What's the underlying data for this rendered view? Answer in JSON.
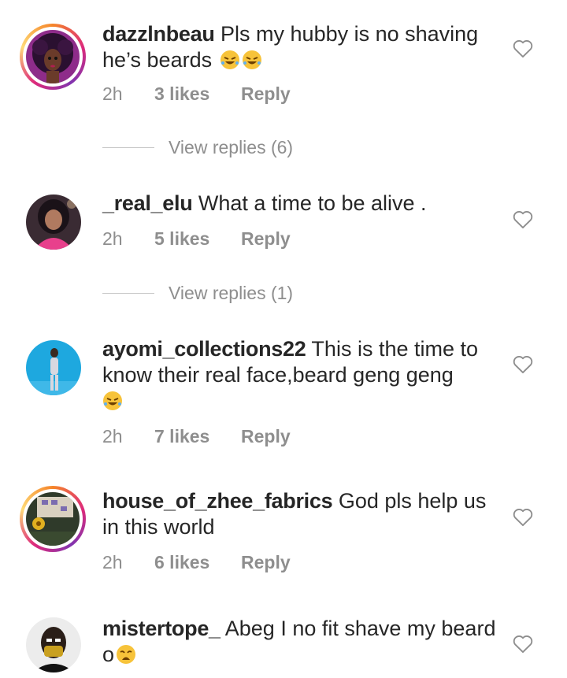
{
  "comments": [
    {
      "username": "dazzlnbeau",
      "text": " Pls my hubby is no shaving he’s beards ",
      "emojis": [
        "rofl-emoji",
        "rofl-emoji"
      ],
      "time": "2h",
      "likes": "3 likes",
      "reply": "Reply",
      "has_story_ring": true,
      "view_replies": "View replies (6)"
    },
    {
      "username": "_real_elu",
      "text": " What a time to be alive .",
      "emojis": [],
      "time": "2h",
      "likes": "5 likes",
      "reply": "Reply",
      "has_story_ring": false,
      "view_replies": "View replies (1)"
    },
    {
      "username": "ayomi_collections22",
      "text": " This is the time to know their real face,beard geng geng ",
      "emojis": [
        "rofl-emoji"
      ],
      "time": "2h",
      "likes": "7 likes",
      "reply": "Reply",
      "has_story_ring": false
    },
    {
      "username": "house_of_zhee_fabrics",
      "text": " God pls help us in this world",
      "emojis": [],
      "time": "2h",
      "likes": "6 likes",
      "reply": "Reply",
      "has_story_ring": true
    },
    {
      "username": "mistertope_",
      "text": " Abeg I no fit shave my beard o",
      "emojis": [
        "weary-face-emoji"
      ],
      "has_story_ring": false
    }
  ],
  "colors": {
    "text": "#262626",
    "meta": "#8e8e8e",
    "story_ring": [
      "#f58529",
      "#dd2a7b",
      "#8134af",
      "#feda77"
    ],
    "emoji": "#f7c33a"
  },
  "icons": {
    "like": "heart-outline-icon"
  }
}
